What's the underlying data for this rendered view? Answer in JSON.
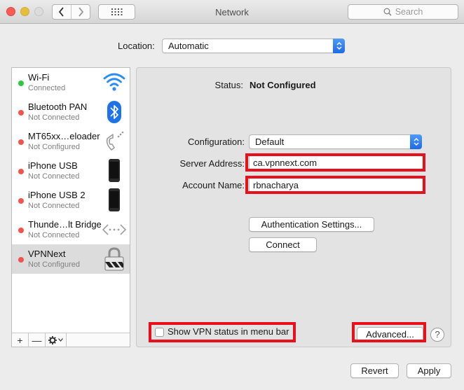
{
  "window": {
    "title": "Network"
  },
  "toolbar": {
    "search_placeholder": "Search"
  },
  "location": {
    "label": "Location:",
    "value": "Automatic"
  },
  "services": [
    {
      "name": "Wi-Fi",
      "status": "Connected",
      "status_color": "#2fc744",
      "icon": "wifi-icon"
    },
    {
      "name": "Bluetooth PAN",
      "status": "Not Connected",
      "status_color": "#f2544b",
      "icon": "bluetooth-icon"
    },
    {
      "name": "MT65xx…eloader",
      "status": "Not Configured",
      "status_color": "#f2544b",
      "icon": "phone-handset-icon"
    },
    {
      "name": "iPhone USB",
      "status": "Not Connected",
      "status_color": "#f2544b",
      "icon": "iphone-icon"
    },
    {
      "name": "iPhone USB 2",
      "status": "Not Connected",
      "status_color": "#f2544b",
      "icon": "iphone-icon"
    },
    {
      "name": "Thunde…lt Bridge",
      "status": "Not Connected",
      "status_color": "#f2544b",
      "icon": "thunderbolt-bridge-icon"
    },
    {
      "name": "VPNNext",
      "status": "Not Configured",
      "status_color": "#f2544b",
      "icon": "vpn-lock-icon",
      "selected": true
    }
  ],
  "sidebar_actions": {
    "add": "+",
    "remove": "—"
  },
  "detail": {
    "status_label": "Status:",
    "status_value": "Not Configured",
    "configuration_label": "Configuration:",
    "configuration_value": "Default",
    "server_address_label": "Server Address:",
    "server_address_value": "ca.vpnnext.com",
    "account_name_label": "Account Name:",
    "account_name_value": "rbnacharya",
    "auth_settings_button": "Authentication Settings...",
    "connect_button": "Connect",
    "show_vpn_status_label": "Show VPN status in menu bar",
    "show_vpn_status_checked": false,
    "advanced_button": "Advanced...",
    "help_button": "?"
  },
  "footer": {
    "revert_button": "Revert",
    "apply_button": "Apply"
  },
  "colors": {
    "highlight": "#e8101c",
    "accent": "#1d6ae8"
  }
}
